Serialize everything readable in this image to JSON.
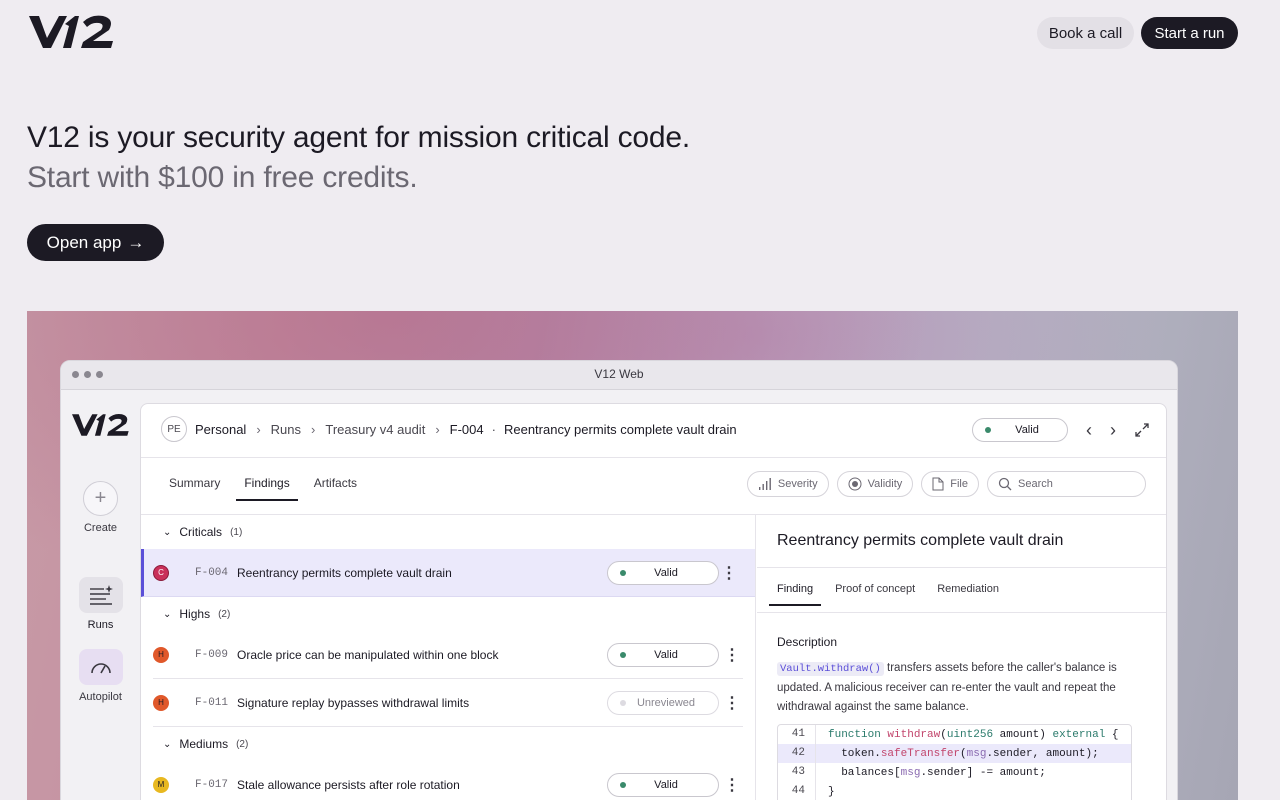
{
  "brand": {
    "logo": "V12"
  },
  "nav": {
    "book_call": "Book a call",
    "start_run": "Start a run"
  },
  "hero": {
    "headline": "V12 is your security agent for mission critical code.",
    "subline": "Start with $100 in free credits.",
    "cta": "Open app"
  },
  "window": {
    "title": "V12 Web"
  },
  "rail": {
    "create": "Create",
    "runs": "Runs",
    "autopilot": "Autopilot"
  },
  "breadcrumb": {
    "avatar": "PE",
    "workspace": "Personal",
    "section": "Runs",
    "project": "Treasury v4 audit",
    "finding_id": "F-004",
    "separator": "·",
    "finding_title": "Reentrancy permits complete vault drain"
  },
  "header": {
    "status": "Valid"
  },
  "tabs": [
    "Summary",
    "Findings",
    "Artifacts"
  ],
  "filters": {
    "severity": "Severity",
    "validity": "Validity",
    "file": "File",
    "search_placeholder": "Search"
  },
  "groups": [
    {
      "label": "Criticals",
      "count": "(1)",
      "rows": [
        {
          "sev": "C",
          "sev_color": "#c9305a",
          "id": "F-004",
          "title": "Reentrancy permits complete vault drain",
          "status": "Valid",
          "selected": true
        }
      ]
    },
    {
      "label": "Highs",
      "count": "(2)",
      "rows": [
        {
          "sev": "H",
          "sev_color": "#e0582a",
          "id": "F-009",
          "title": "Oracle price can be manipulated within one block",
          "status": "Valid"
        },
        {
          "sev": "H",
          "sev_color": "#e0582a",
          "id": "F-011",
          "title": "Signature replay bypasses withdrawal limits",
          "status": "Unreviewed"
        }
      ]
    },
    {
      "label": "Mediums",
      "count": "(2)",
      "rows": [
        {
          "sev": "M",
          "sev_color": "#e8b820",
          "id": "F-017",
          "title": "Stale allowance persists after role rotation",
          "status": "Valid"
        }
      ]
    }
  ],
  "detail": {
    "title": "Reentrancy permits complete vault drain",
    "tabs": [
      "Finding",
      "Proof of concept",
      "Remediation"
    ],
    "heading": "Description",
    "code_ref": "Vault.withdraw()",
    "text": "transfers assets before the caller's balance is updated. A malicious receiver can re-enter the vault and repeat the withdrawal against the same balance.",
    "code": [
      {
        "n": "41",
        "t": "function withdraw(uint256 amount) external {"
      },
      {
        "n": "42",
        "t": "  token.safeTransfer(msg.sender, amount);"
      },
      {
        "n": "43",
        "t": "  balances[msg.sender] -= amount;"
      },
      {
        "n": "44",
        "t": "}"
      }
    ]
  }
}
